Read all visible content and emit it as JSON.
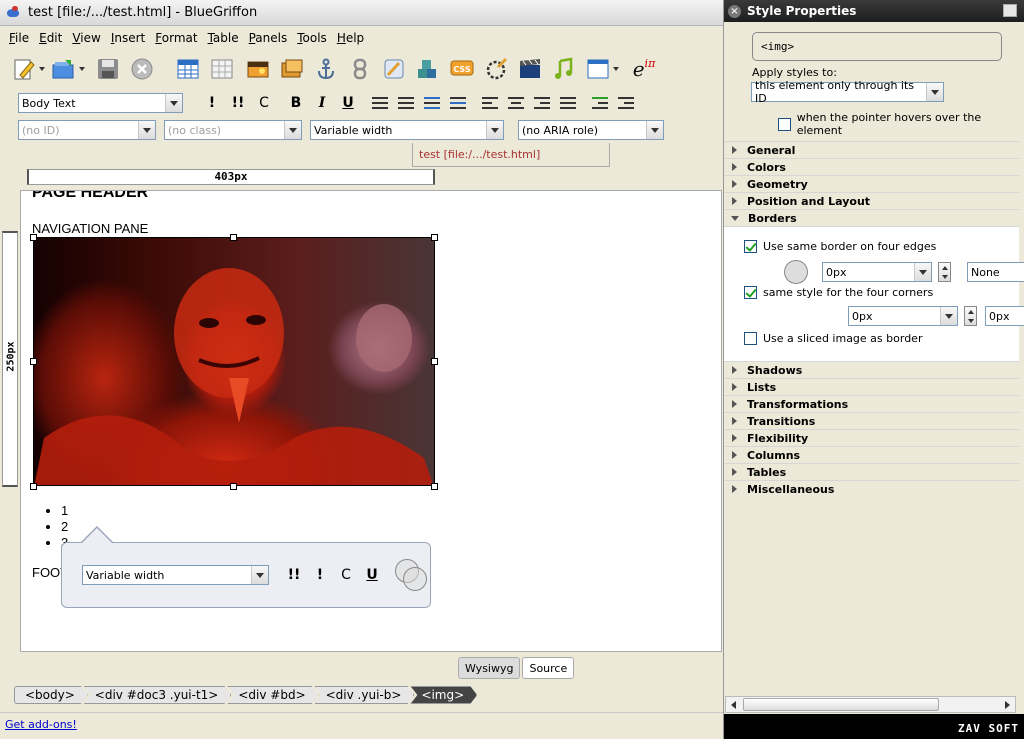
{
  "window": {
    "title": "test [file:/.../test.html] - BlueGriffon"
  },
  "menubar": [
    "File",
    "Edit",
    "View",
    "Insert",
    "Format",
    "Table",
    "Panels",
    "Tools",
    "Help"
  ],
  "toolbar1": {
    "icons": [
      "new-document-icon",
      "open-document-icon",
      "save-icon",
      "stop-icon",
      "table-icon",
      "table-grid-icon",
      "image-icon",
      "image-edit-icon",
      "anchor-icon",
      "link-icon",
      "edit-link-icon",
      "blocks-icon",
      "css-icon",
      "plugin-icon",
      "video-icon",
      "audio-icon",
      "form-icon",
      "math-icon"
    ],
    "math_label": "e",
    "math_sup": "iπ"
  },
  "toolbar2": {
    "paragraph_style": "Body Text",
    "strong_label": "!",
    "emphasis_label": "!!",
    "code_label": "C",
    "bold_label": "B",
    "italic_label": "I",
    "underline_label": "U"
  },
  "toolbar3": {
    "id_select": "(no ID)",
    "class_select": "(no class)",
    "width_select": "Variable width",
    "aria_select": "(no ARIA role)"
  },
  "document_tab": "test [file:/.../test.html]",
  "rulers": {
    "horizontal": "403px",
    "vertical": "250px"
  },
  "editor": {
    "page_header": "PAGE HEADER",
    "navigation": "NAVIGATION PANE",
    "list_items": [
      "1",
      "2",
      "3"
    ],
    "footer": "FOOTER"
  },
  "popup": {
    "width_select": "Variable width",
    "emphasis_label": "!!",
    "strong_label": "!",
    "code_label": "C",
    "underline_label": "U"
  },
  "view_modes": {
    "wysiwyg": "Wysiwyg",
    "source": "Source"
  },
  "breadcrumb": [
    "<body>",
    "<div #doc3 .yui-t1>",
    "<div #bd>",
    "<div .yui-b>",
    "<img>"
  ],
  "statusbar": {
    "addons_link": "Get add-ons!"
  },
  "panel": {
    "title": "Style Properties",
    "selector": "<img>",
    "apply_label": "Apply styles to:",
    "apply_value": "this element only through its ID",
    "hover_label": "when the pointer hovers over the element",
    "sections_top": [
      "General",
      "Colors",
      "Geometry",
      "Position and Layout"
    ],
    "borders_title": "Borders",
    "borders": {
      "same_border_label": "Use same border on four edges",
      "width_value": "0px",
      "style_value": "None",
      "corners_label": "same style for the four corners",
      "radius_value": "0px",
      "radius_value2": "0px",
      "sliced_label": "Use a sliced image as border"
    },
    "sections_bottom": [
      "Shadows",
      "Lists",
      "Transformations",
      "Transitions",
      "Flexibility",
      "Columns",
      "Tables",
      "Miscellaneous"
    ]
  },
  "watermark": "ZAV SOFT"
}
